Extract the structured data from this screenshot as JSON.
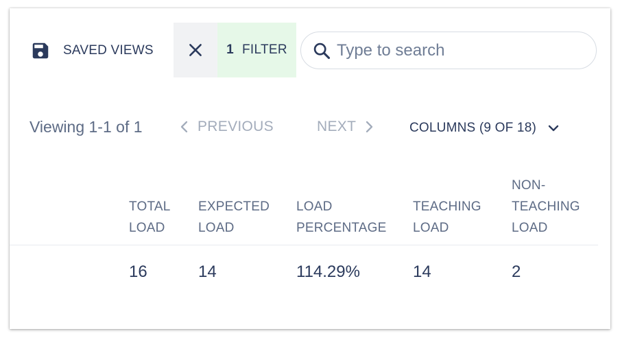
{
  "toolbar": {
    "saved_views_label": "SAVED VIEWS",
    "filter_count": "1",
    "filter_label": "FILTER",
    "search_placeholder": "Type to search"
  },
  "pagination": {
    "viewing_text": "Viewing 1-1 of 1",
    "previous_label": "PREVIOUS",
    "next_label": "NEXT",
    "columns_label": "COLUMNS (9 OF 18)"
  },
  "table": {
    "columns": [
      {
        "line1": "TOTAL",
        "line2": "LOAD"
      },
      {
        "line1": "EXPECTED",
        "line2": "LOAD"
      },
      {
        "line1": "LOAD",
        "line2": "PERCENTAGE"
      },
      {
        "line1": "TEACHING",
        "line2": "LOAD"
      },
      {
        "line0": "NON-",
        "line1": "TEACHING",
        "line2": "LOAD"
      }
    ],
    "rows": [
      [
        "16",
        "14",
        "114.29%",
        "14",
        "2"
      ]
    ]
  },
  "icons": {
    "saved_views": "floppy-disk-icon",
    "clear_filter": "close-icon",
    "search": "search-icon",
    "previous": "chevron-left-icon",
    "next": "chevron-right-icon",
    "columns": "chevron-down-icon"
  },
  "colors": {
    "text_primary": "#2b3a5c",
    "text_secondary": "#5d6b85",
    "text_disabled": "#a3acbb",
    "filter_chip_bg": "#e6f8e8",
    "clear_button_bg": "#f1f2f4"
  }
}
